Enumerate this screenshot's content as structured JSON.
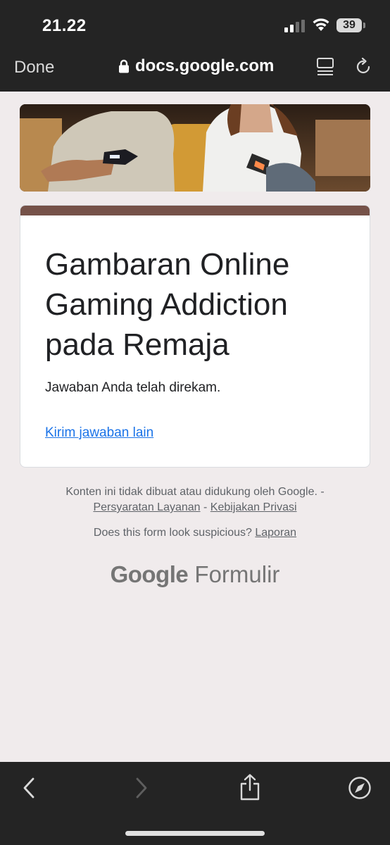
{
  "status_bar": {
    "time": "21.22",
    "battery": "39"
  },
  "browser": {
    "done_label": "Done",
    "url": "docs.google.com"
  },
  "form": {
    "title": "Gambaran Online Gaming Addiction pada Remaja",
    "confirmation": "Jawaban Anda telah direkam.",
    "submit_another": "Kirim jawaban lain",
    "accent_color": "#765249"
  },
  "footer": {
    "disclaimer": "Konten ini tidak dibuat atau didukung oleh Google. -",
    "terms_link": "Persyaratan Layanan",
    "separator": "-",
    "privacy_link": "Kebijakan Privasi",
    "suspicious_text": "Does this form look suspicious?",
    "report_link": "Laporan",
    "brand_google": "Google",
    "brand_product": "Formulir"
  },
  "toolbar": {
    "icons": [
      "back-icon",
      "forward-icon",
      "share-icon",
      "compass-icon"
    ]
  }
}
